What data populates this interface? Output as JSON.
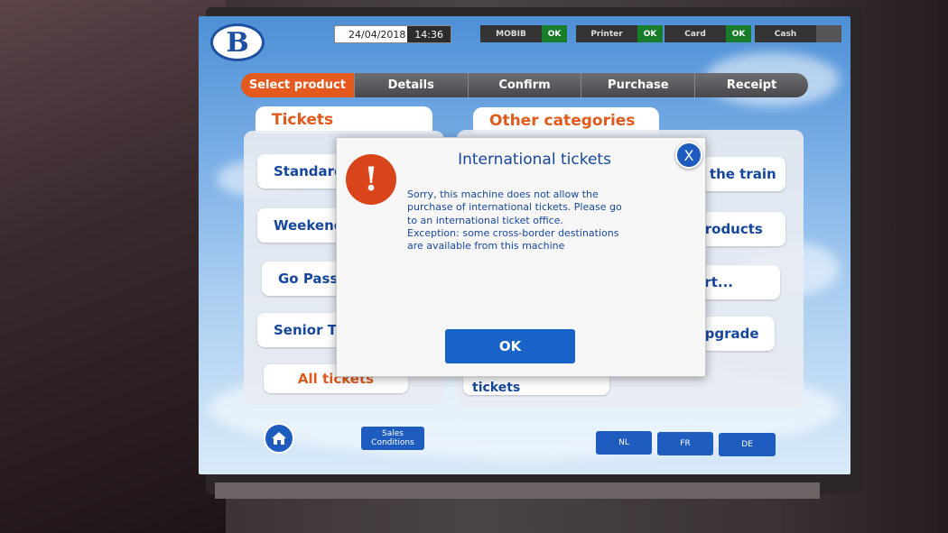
{
  "brand": {
    "logo_letter": "B"
  },
  "status_bar": {
    "date": "24/04/2018",
    "time": "14:36",
    "devices": [
      {
        "label": "MOBIB",
        "status": "OK"
      },
      {
        "label": "Printer",
        "status": "OK"
      },
      {
        "label": "Card",
        "status": "OK"
      },
      {
        "label": "Cash",
        "status": ""
      }
    ]
  },
  "steps": [
    {
      "label": "Select product",
      "active": true
    },
    {
      "label": "Details",
      "active": false
    },
    {
      "label": "Confirm",
      "active": false
    },
    {
      "label": "Purchase",
      "active": false
    },
    {
      "label": "Receipt",
      "active": false
    }
  ],
  "tickets_panel": {
    "title": "Tickets",
    "items": [
      "Standard",
      "Weekend",
      "Go Pass 1",
      "Senior Tick"
    ],
    "all_label": "All tickets"
  },
  "other_panel": {
    "title": "Other categories",
    "items": [
      "n the train",
      "products",
      "ort...",
      "upgrade"
    ],
    "international_label": "International tickets"
  },
  "bottom_bar": {
    "home_icon": "home-icon",
    "sales_conditions": "Sales Conditions",
    "languages": [
      "NL",
      "FR",
      "DE"
    ]
  },
  "dialog": {
    "title": "International tickets",
    "close_label": "X",
    "icon_glyph": "!",
    "message_lines": [
      "Sorry, this machine does not allow the",
      "purchase of international tickets. Please go",
      "to an international ticket office.",
      "Exception: some cross-border destinations",
      "are available from this machine"
    ],
    "ok_label": "OK"
  },
  "colors": {
    "accent_orange": "#e45a1e",
    "brand_blue": "#1e5cc0",
    "ok_green": "#177d2a"
  }
}
